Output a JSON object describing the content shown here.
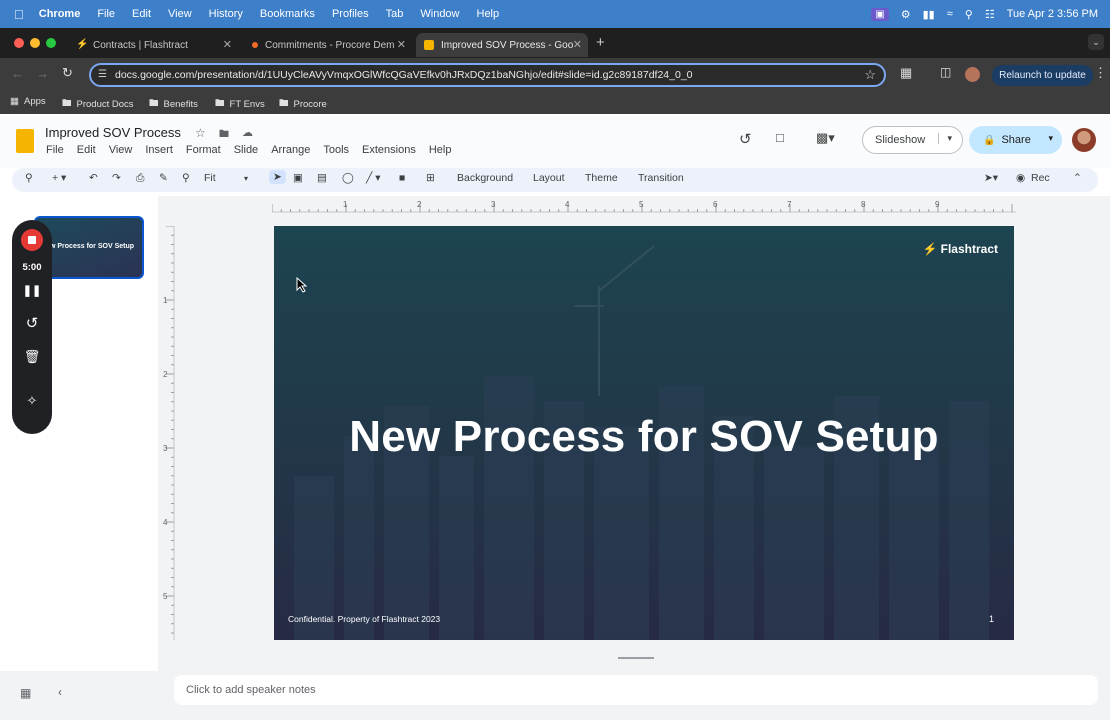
{
  "menubar": {
    "app": "Chrome",
    "items": [
      "File",
      "Edit",
      "View",
      "History",
      "Bookmarks",
      "Profiles",
      "Tab",
      "Window",
      "Help"
    ],
    "datetime": "Tue Apr 2  3:56 PM"
  },
  "tabs": [
    {
      "title": "Contracts | Flashtract"
    },
    {
      "title": "Commitments - Procore Dem"
    },
    {
      "title": "Improved SOV Process - Goo"
    }
  ],
  "address": {
    "url": "docs.google.com/presentation/d/1UUyCleAVyVmqxOGlWfcQGaVEfkv0hJRxDQz1baNGhjo/edit#slide=id.g2c89187df24_0_0"
  },
  "relaunch_label": "Relaunch to update",
  "bookmarks": [
    "Apps",
    "Product Docs",
    "Benefits",
    "FT Envs",
    "Procore"
  ],
  "doc": {
    "title": "Improved SOV Process",
    "menu": [
      "File",
      "Edit",
      "View",
      "Insert",
      "Format",
      "Slide",
      "Arrange",
      "Tools",
      "Extensions",
      "Help"
    ],
    "slideshow_label": "Slideshow",
    "share_label": "Share"
  },
  "edit_toolbar": {
    "zoom": "Fit",
    "background": "Background",
    "layout": "Layout",
    "theme": "Theme",
    "transition": "Transition",
    "rec": "Rec"
  },
  "ruler": {
    "h": [
      "1",
      "2",
      "3",
      "4",
      "5",
      "6",
      "7",
      "8",
      "9"
    ],
    "v": [
      "1",
      "2",
      "3",
      "4",
      "5"
    ]
  },
  "recorder": {
    "time": "5:00"
  },
  "thumbnail": {
    "title": "w Process for SOV Setup"
  },
  "slide": {
    "title": "New Process for SOV Setup",
    "brand": "Flashtract",
    "footer": "Confidential. Property of Flashtract 2023",
    "page": "1"
  },
  "notes_placeholder": "Click to add speaker notes"
}
